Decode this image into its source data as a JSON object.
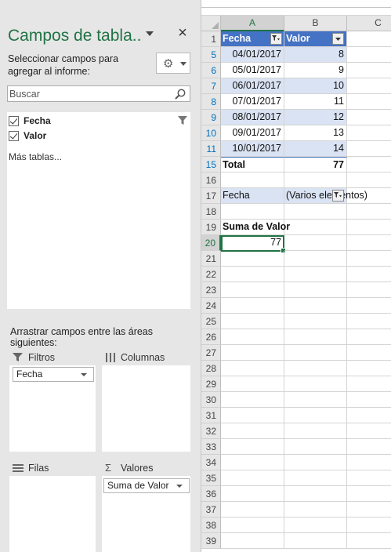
{
  "pane": {
    "title": "Campos de tabla..",
    "close_label": "×",
    "instruction": "Seleccionar campos para agregar al informe:",
    "search_placeholder": "Buscar",
    "fields": [
      {
        "label": "Fecha",
        "checked": true
      },
      {
        "label": "Valor",
        "checked": true
      }
    ],
    "more_tables": "Más tablas...",
    "drag_instruction": "Arrastrar campos entre las áreas siguientes:",
    "areas": {
      "filters": {
        "label": "Filtros",
        "items": [
          "Fecha"
        ]
      },
      "columns": {
        "label": "Columnas",
        "items": []
      },
      "rows": {
        "label": "Filas",
        "items": []
      },
      "values": {
        "label": "Valores",
        "items": [
          "Suma de Valor"
        ]
      }
    },
    "icons": {
      "gear": "gear-icon",
      "search": "search-icon",
      "filter": "funnel-icon"
    }
  },
  "sheet": {
    "columns": [
      "A",
      "B",
      "C"
    ],
    "active_column": "A",
    "table": {
      "headers": [
        "Fecha",
        "Valor"
      ],
      "rows": [
        {
          "row": "5",
          "fecha": "04/01/2017",
          "valor": "8"
        },
        {
          "row": "6",
          "fecha": "05/01/2017",
          "valor": "9"
        },
        {
          "row": "7",
          "fecha": "06/01/2017",
          "valor": "10"
        },
        {
          "row": "8",
          "fecha": "07/01/2017",
          "valor": "11"
        },
        {
          "row": "9",
          "fecha": "08/01/2017",
          "valor": "12"
        },
        {
          "row": "10",
          "fecha": "09/01/2017",
          "valor": "13"
        },
        {
          "row": "11",
          "fecha": "10/01/2017",
          "valor": "14"
        }
      ],
      "total_row": {
        "row": "15",
        "label": "Total",
        "value": "77"
      }
    },
    "pivot": {
      "filter_row": "17",
      "filter_field": "Fecha",
      "filter_value": "(Varios elementos)",
      "value_header_row": "19",
      "value_header": "Suma de Valor",
      "value_row": "20",
      "value": "77"
    },
    "row_numbers": [
      "1",
      "5",
      "6",
      "7",
      "8",
      "9",
      "10",
      "11",
      "15",
      "16",
      "17",
      "18",
      "19",
      "20",
      "21",
      "22",
      "23",
      "24",
      "25",
      "26",
      "27",
      "28",
      "29",
      "30",
      "31",
      "32",
      "33",
      "34",
      "35",
      "36",
      "37",
      "38",
      "39"
    ],
    "active_row": "20",
    "filtered_rows": [
      "5",
      "6",
      "7",
      "8",
      "9",
      "10",
      "11",
      "15"
    ],
    "colors": {
      "accent": "#217346",
      "table_header": "#4472c4",
      "table_band": "#dae3f3",
      "filtered_row_number": "#0070c0"
    }
  }
}
